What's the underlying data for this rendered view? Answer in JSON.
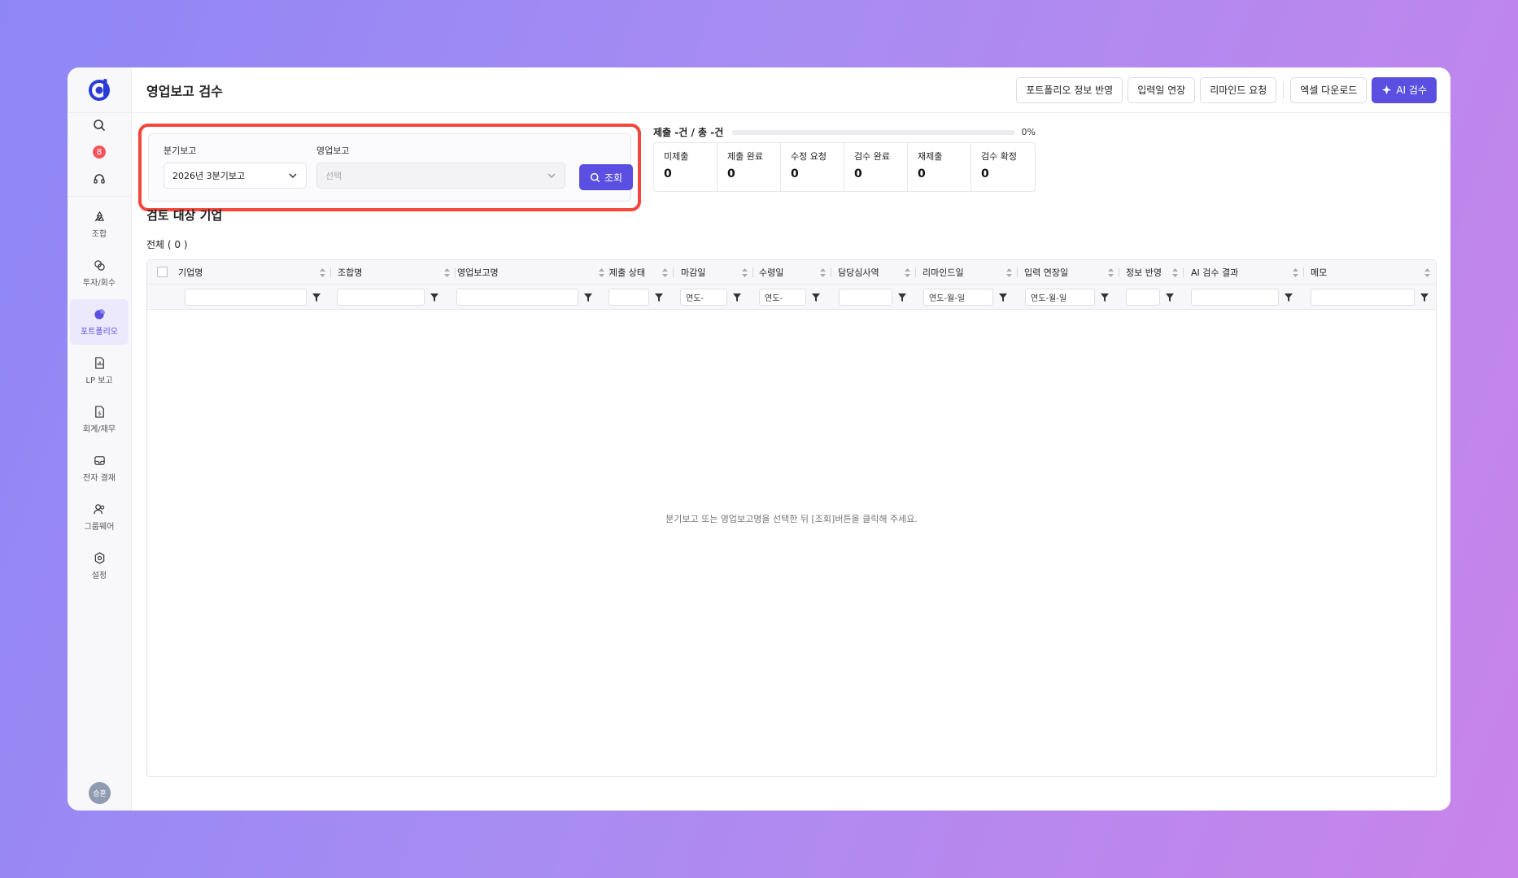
{
  "sidebar": {
    "notification_count": "8",
    "items": [
      {
        "label": "조합",
        "icon": "recycle-icon"
      },
      {
        "label": "투자/회수",
        "icon": "exchange-icon"
      },
      {
        "label": "포트폴리오",
        "icon": "pie-chart-icon"
      },
      {
        "label": "LP 보고",
        "icon": "report-icon"
      },
      {
        "label": "회계/재무",
        "icon": "dollar-doc-icon"
      },
      {
        "label": "전자 결재",
        "icon": "inbox-icon"
      },
      {
        "label": "그룹웨어",
        "icon": "users-icon"
      },
      {
        "label": "설정",
        "icon": "gear-icon"
      }
    ],
    "avatar_text": "승훈"
  },
  "header": {
    "title": "영업보고 검수",
    "actions": {
      "reflect": "포트폴리오 정보 반영",
      "extend": "입력일 연장",
      "remind": "리마인드 요청",
      "excel": "엑셀 다운로드",
      "ai": "AI 검수"
    }
  },
  "filter": {
    "quarter_label": "분기보고",
    "quarter_value": "2026년 3분기보고",
    "report_label": "영업보고",
    "report_placeholder": "선택",
    "search_label": "조회"
  },
  "progress": {
    "label": "제출 -건 / 총 -건",
    "percent_text": "0%",
    "fraction": 0
  },
  "stats": [
    {
      "label": "미제출",
      "value": "0"
    },
    {
      "label": "제출 완료",
      "value": "0"
    },
    {
      "label": "수정 요청",
      "value": "0"
    },
    {
      "label": "검수 완료",
      "value": "0"
    },
    {
      "label": "재제출",
      "value": "0"
    },
    {
      "label": "검수 확정",
      "value": "0"
    }
  ],
  "section_title": "검토 대상 기업",
  "count_label": "전체 ( 0 )",
  "grid": {
    "columns": [
      "기업명",
      "조합명",
      "영업보고명",
      "제출 상태",
      "마감일",
      "수령일",
      "담당심사역",
      "리마인드일",
      "입력 연장일",
      "정보 반영",
      "AI 검수 결과",
      "메모"
    ],
    "filters": [
      "",
      "",
      "",
      "",
      "연도-",
      "연도-",
      "",
      "연도-월-일",
      "연도-월-일",
      "",
      "",
      ""
    ],
    "empty_message": "분기보고 또는 영업보고명을 선택한 뒤 [조회]버튼을 클릭해 주세요."
  }
}
